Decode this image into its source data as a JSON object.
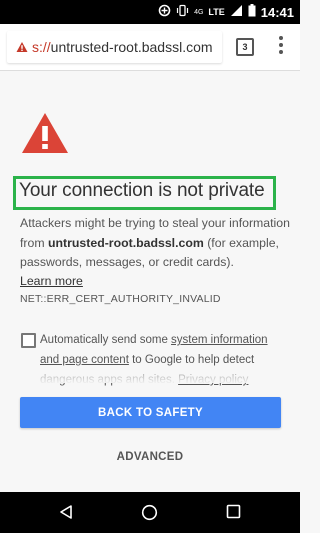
{
  "status_bar": {
    "time": "14:41",
    "network": "4G",
    "network_sub": "LTE",
    "icons": [
      "data-saver-icon",
      "vibrate-icon",
      "signal-icon",
      "battery-icon"
    ]
  },
  "browser": {
    "url_scheme": "s://",
    "url_host": "untrusted-root.badssl.com",
    "tab_count": "3",
    "security_state": "not-secure",
    "accent_insecure": "#c53929"
  },
  "interstitial": {
    "title": "Your connection is not private",
    "desc_before": "Attackers might be trying to steal your information from ",
    "desc_host": "untrusted-root.badssl.com",
    "desc_after": " (for example, passwords, messages, or credit cards).",
    "learn_more": "Learn more",
    "error_code": "NET::ERR_CERT_AUTHORITY_INVALID",
    "checkbox_before": "Automatically send some ",
    "checkbox_link1": "system information and page content",
    "checkbox_middle": " to Google to help detect dangerous apps and sites. ",
    "checkbox_link2": "Privacy policy",
    "checkbox_checked": false,
    "primary_button": "BACK TO SAFETY",
    "secondary_button": "ADVANCED",
    "colors": {
      "primary": "#4285f4",
      "warning": "#db4437",
      "highlight": "#2bb34a"
    }
  },
  "nav_bar": {
    "icons": [
      "back-icon",
      "home-icon",
      "recents-icon"
    ]
  }
}
